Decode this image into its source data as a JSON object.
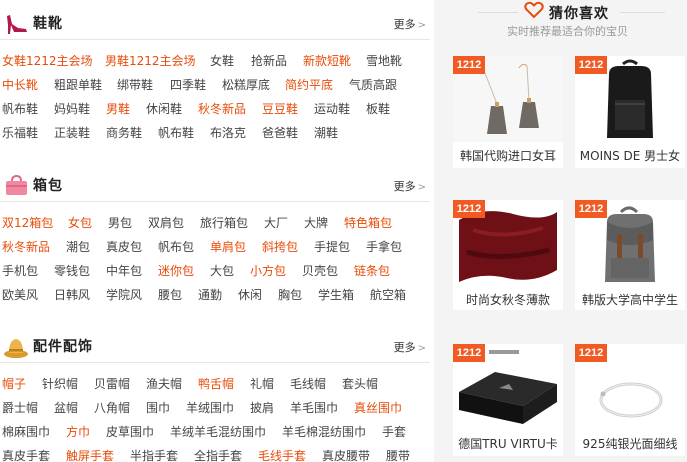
{
  "shoes": {
    "title": "鞋靴",
    "more": "更多",
    "rows": [
      [
        {
          "t": "女鞋1212主会场",
          "hot": true
        },
        {
          "t": "男鞋1212主会场",
          "hot": true
        },
        {
          "t": "女鞋",
          "hot": false
        },
        {
          "t": "抢新品",
          "hot": false
        },
        {
          "t": "新款短靴",
          "hot": true
        },
        {
          "t": "雪地靴",
          "hot": false
        }
      ],
      [
        {
          "t": "中长靴",
          "hot": true
        },
        {
          "t": "粗跟单鞋",
          "hot": false
        },
        {
          "t": "绑带鞋",
          "hot": false
        },
        {
          "t": "四季鞋",
          "hot": false
        },
        {
          "t": "松糕厚底",
          "hot": false
        },
        {
          "t": "简约平底",
          "hot": true
        },
        {
          "t": "气质高跟",
          "hot": false
        }
      ],
      [
        {
          "t": "帆布鞋",
          "hot": false
        },
        {
          "t": "妈妈鞋",
          "hot": false
        },
        {
          "t": "男鞋",
          "hot": true
        },
        {
          "t": "休闲鞋",
          "hot": false
        },
        {
          "t": "秋冬新品",
          "hot": true
        },
        {
          "t": "豆豆鞋",
          "hot": true
        },
        {
          "t": "运动鞋",
          "hot": false
        },
        {
          "t": "板鞋",
          "hot": false
        }
      ],
      [
        {
          "t": "乐福鞋",
          "hot": false
        },
        {
          "t": "正装鞋",
          "hot": false
        },
        {
          "t": "商务鞋",
          "hot": false
        },
        {
          "t": "帆布鞋",
          "hot": false
        },
        {
          "t": "布洛克",
          "hot": false
        },
        {
          "t": "爸爸鞋",
          "hot": false
        },
        {
          "t": "潮鞋",
          "hot": false
        }
      ]
    ]
  },
  "bags": {
    "title": "箱包",
    "more": "更多",
    "rows": [
      [
        {
          "t": "双12箱包",
          "hot": true
        },
        {
          "t": "女包",
          "hot": true
        },
        {
          "t": "男包",
          "hot": false
        },
        {
          "t": "双肩包",
          "hot": false
        },
        {
          "t": "旅行箱包",
          "hot": false
        },
        {
          "t": "大厂",
          "hot": false
        },
        {
          "t": "大牌",
          "hot": false
        },
        {
          "t": "特色箱包",
          "hot": true
        }
      ],
      [
        {
          "t": "秋冬新品",
          "hot": true
        },
        {
          "t": "潮包",
          "hot": false
        },
        {
          "t": "真皮包",
          "hot": false
        },
        {
          "t": "帆布包",
          "hot": false
        },
        {
          "t": "单肩包",
          "hot": true
        },
        {
          "t": "斜挎包",
          "hot": true
        },
        {
          "t": "手提包",
          "hot": false
        },
        {
          "t": "手拿包",
          "hot": false
        }
      ],
      [
        {
          "t": "手机包",
          "hot": false
        },
        {
          "t": "零钱包",
          "hot": false
        },
        {
          "t": "中年包",
          "hot": false
        },
        {
          "t": "迷你包",
          "hot": true
        },
        {
          "t": "大包",
          "hot": false
        },
        {
          "t": "小方包",
          "hot": true
        },
        {
          "t": "贝壳包",
          "hot": false
        },
        {
          "t": "链条包",
          "hot": true
        }
      ],
      [
        {
          "t": "欧美风",
          "hot": false
        },
        {
          "t": "日韩风",
          "hot": false
        },
        {
          "t": "学院风",
          "hot": false
        },
        {
          "t": "腰包",
          "hot": false
        },
        {
          "t": "通勤",
          "hot": false
        },
        {
          "t": "休闲",
          "hot": false
        },
        {
          "t": "胸包",
          "hot": false
        },
        {
          "t": "学生箱",
          "hot": false
        },
        {
          "t": "航空箱",
          "hot": false
        }
      ]
    ]
  },
  "accessories": {
    "title": "配件配饰",
    "more": "更多",
    "rows": [
      [
        {
          "t": "帽子",
          "hot": true
        },
        {
          "t": "针织帽",
          "hot": false
        },
        {
          "t": "贝雷帽",
          "hot": false
        },
        {
          "t": "渔夫帽",
          "hot": false
        },
        {
          "t": "鸭舌帽",
          "hot": true
        },
        {
          "t": "礼帽",
          "hot": false
        },
        {
          "t": "毛线帽",
          "hot": false
        },
        {
          "t": "套头帽",
          "hot": false
        }
      ],
      [
        {
          "t": "爵士帽",
          "hot": false
        },
        {
          "t": "盆帽",
          "hot": false
        },
        {
          "t": "八角帽",
          "hot": false
        },
        {
          "t": "围巾",
          "hot": false
        },
        {
          "t": "羊绒围巾",
          "hot": false
        },
        {
          "t": "披肩",
          "hot": false
        },
        {
          "t": "羊毛围巾",
          "hot": false
        },
        {
          "t": "真丝围巾",
          "hot": true
        }
      ],
      [
        {
          "t": "棉麻围巾",
          "hot": false
        },
        {
          "t": "方巾",
          "hot": true
        },
        {
          "t": "皮草围巾",
          "hot": false
        },
        {
          "t": "羊绒羊毛混纺围巾",
          "hot": false
        },
        {
          "t": "羊毛棉混纺围巾",
          "hot": false
        },
        {
          "t": "手套",
          "hot": false
        }
      ],
      [
        {
          "t": "真皮手套",
          "hot": false
        },
        {
          "t": "触屏手套",
          "hot": true
        },
        {
          "t": "半指手套",
          "hot": false
        },
        {
          "t": "全指手套",
          "hot": false
        },
        {
          "t": "毛线手套",
          "hot": true
        },
        {
          "t": "真皮腰带",
          "hot": false
        },
        {
          "t": "腰带",
          "hot": false
        }
      ]
    ]
  },
  "recommend": {
    "title": "猜你喜欢",
    "subtitle": "实时推荐最适合你的宝贝",
    "badge": "1212",
    "items": [
      {
        "caption": "韩国代购进口女耳",
        "icon": "tassel-earrings-image"
      },
      {
        "caption": "MOINS DE 男士女",
        "icon": "black-backpack-image"
      },
      {
        "caption": "时尚女秋冬薄款",
        "icon": "burgundy-scarf-image"
      },
      {
        "caption": "韩版大学高中学生",
        "icon": "grey-backpack-image"
      },
      {
        "caption": "德国TRU VIRTU卡",
        "icon": "card-wallet-image"
      },
      {
        "caption": "925纯银光面细线",
        "icon": "silver-bangle-image"
      }
    ]
  },
  "colors": {
    "hot": "#e84c0a",
    "badge": "#f15a22",
    "panel": "#f4f4f4"
  }
}
